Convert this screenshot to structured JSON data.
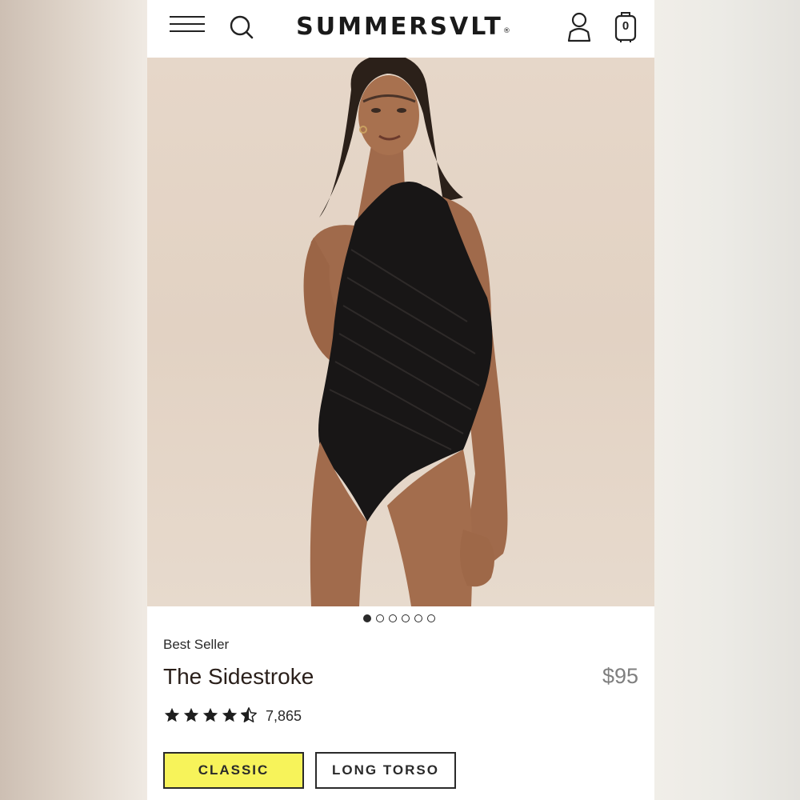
{
  "header": {
    "brand": "SUMMERSVLT",
    "brand_mark": "®",
    "cart_count": "0",
    "icons": [
      "menu-icon",
      "search-icon",
      "account-icon",
      "cart-icon"
    ]
  },
  "gallery": {
    "image": "model-wearing-black-one-shoulder-swimsuit",
    "total_slides": 6,
    "active_slide": 1
  },
  "product": {
    "badge": "Best Seller",
    "name": "The Sidestroke",
    "price": "$95",
    "rating": 4.5,
    "rating_max": 5,
    "review_count": "7,865"
  },
  "fit_options": {
    "selected": "CLASSIC",
    "items": [
      {
        "label": "CLASSIC",
        "selected": true
      },
      {
        "label": "LONG TORSO",
        "selected": false
      }
    ]
  },
  "colors": {
    "selected_fit_bg": "#f7f35a",
    "text": "#2a2a2a",
    "price": "#7f7f7f"
  }
}
